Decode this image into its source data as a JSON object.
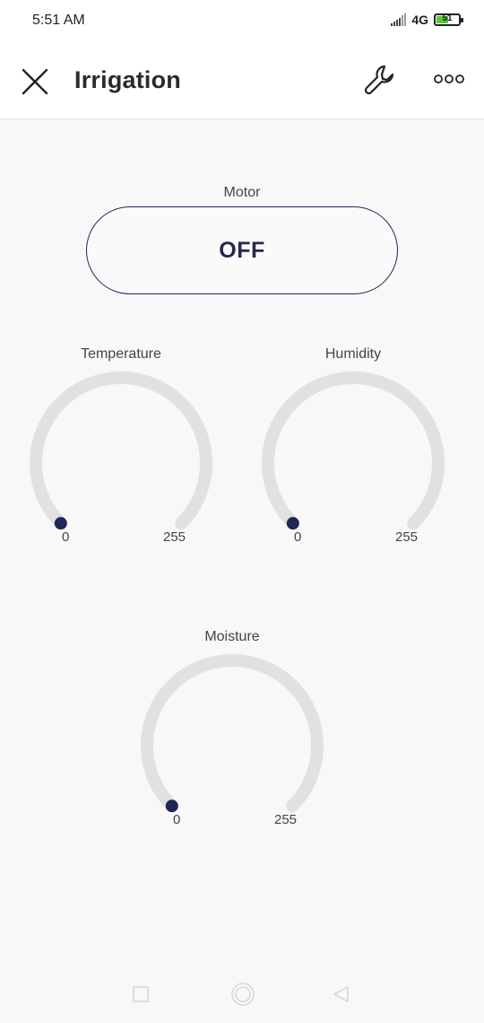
{
  "status_bar": {
    "time": "5:51 AM",
    "network": "4G",
    "battery": "51"
  },
  "header": {
    "title": "Irrigation"
  },
  "motor": {
    "label": "Motor",
    "state": "OFF"
  },
  "gauges": {
    "temperature": {
      "label": "Temperature",
      "min": "0",
      "max": "255",
      "value": 0
    },
    "humidity": {
      "label": "Humidity",
      "min": "0",
      "max": "255",
      "value": 0
    },
    "moisture": {
      "label": "Moisture",
      "min": "0",
      "max": "255",
      "value": 0
    }
  },
  "colors": {
    "accent": "#1f2756",
    "track": "#e1e1e1",
    "background": "#f8f8f8"
  }
}
